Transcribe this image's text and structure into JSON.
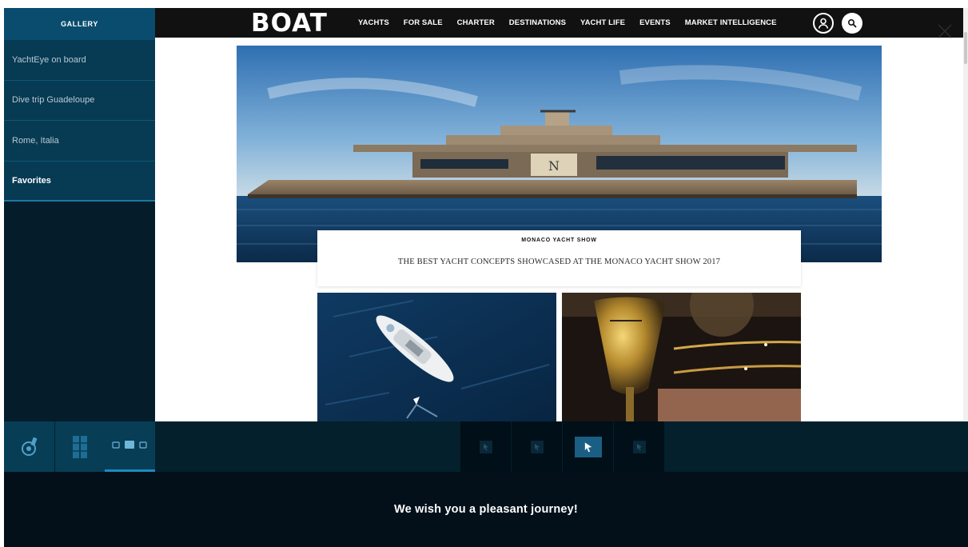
{
  "sidebar": {
    "header": "GALLERY",
    "items": [
      {
        "label": "YachtEye on board"
      },
      {
        "label": "Dive trip Guadeloupe"
      },
      {
        "label": "Rome, Italia"
      },
      {
        "label": "Favorites"
      }
    ],
    "active_index": 3
  },
  "site": {
    "logo": "BOAT",
    "nav": [
      "YACHTS",
      "FOR SALE",
      "CHARTER",
      "DESTINATIONS",
      "YACHT LIFE",
      "EVENTS",
      "MARKET INTELLIGENCE"
    ],
    "icons": [
      "user-account-icon",
      "search-icon"
    ]
  },
  "article": {
    "category": "MONACO YACHT SHOW",
    "headline": "THE BEST YACHT CONCEPTS SHOWCASED AT THE MONACO YACHT SHOW 2017"
  },
  "toolbar": {
    "tools": [
      "brush-icon",
      "panels-icon",
      "view-mode-icon"
    ],
    "slots_count": 4,
    "active_slot": 2
  },
  "footer": {
    "message": "We wish you a pleasant journey!"
  },
  "colors": {
    "sidebar_bg": "#051c2a",
    "sidebar_item": "#073a53",
    "accent": "#1c8bbd",
    "nav_bg": "#111111",
    "footer_bg": "#03101a"
  }
}
